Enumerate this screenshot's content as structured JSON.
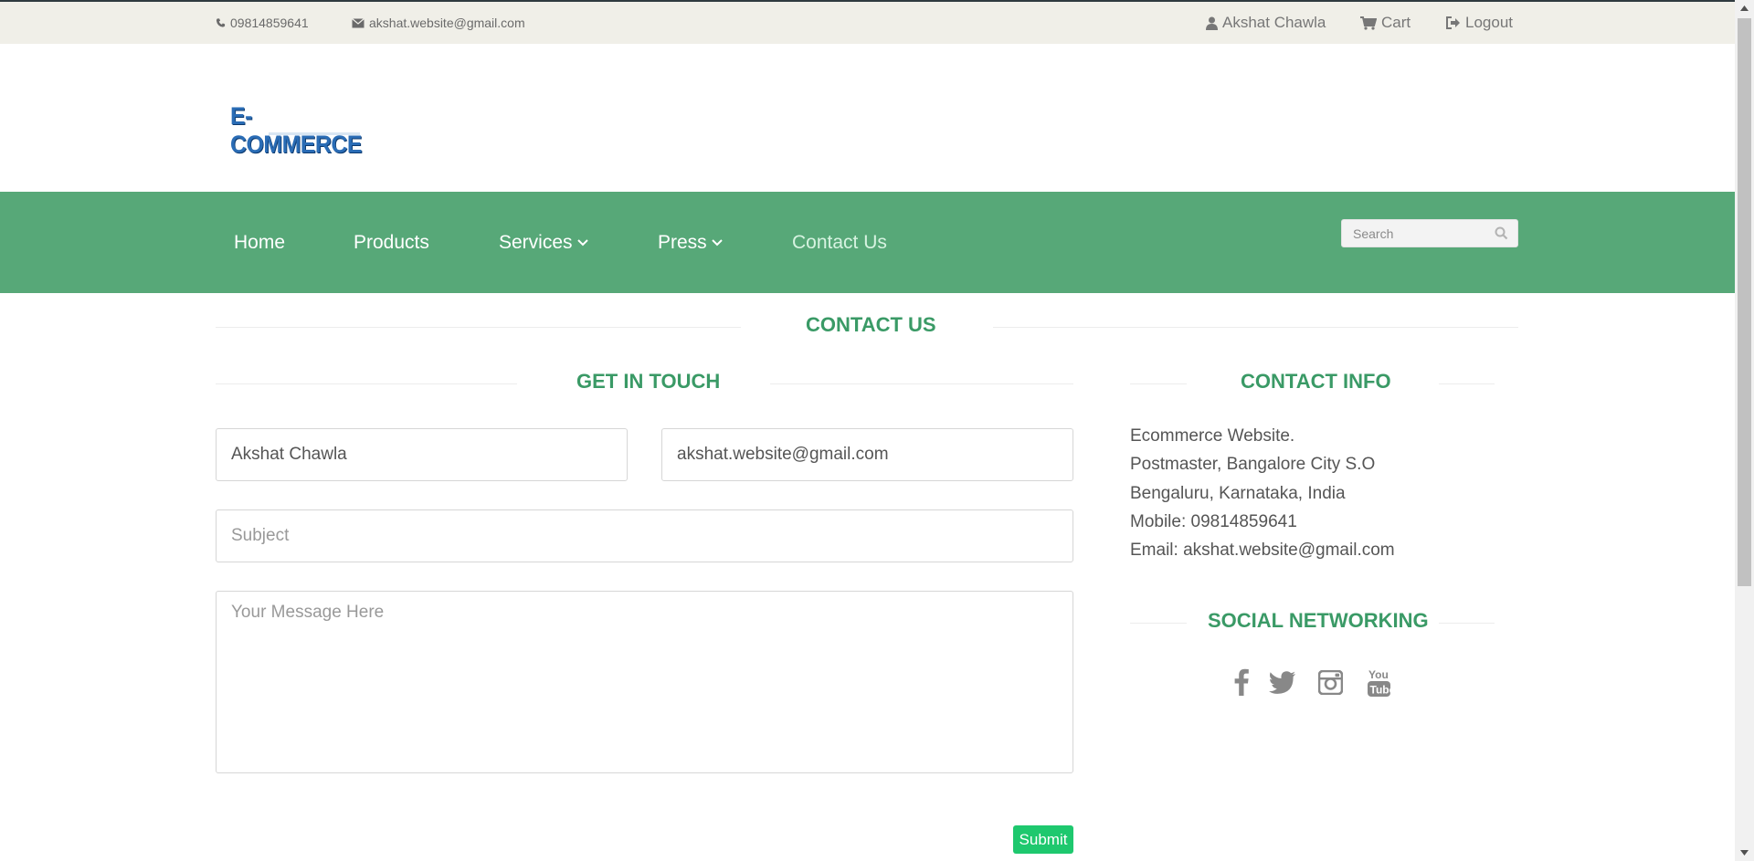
{
  "topbar": {
    "phone": "09814859641",
    "email": "akshat.website@gmail.com",
    "user_name": "Akshat Chawla",
    "cart_label": "Cart",
    "logout_label": "Logout"
  },
  "logo": {
    "text": "E-COMMERCE"
  },
  "nav": {
    "items": [
      {
        "label": "Home"
      },
      {
        "label": "Products"
      },
      {
        "label": "Services"
      },
      {
        "label": "Press"
      },
      {
        "label": "Contact Us"
      }
    ],
    "search_placeholder": "Search"
  },
  "page": {
    "title": "CONTACT US",
    "form_title": "GET IN TOUCH",
    "info_title": "CONTACT INFO",
    "social_title": "SOCIAL NETWORKING"
  },
  "form": {
    "name_value": "Akshat Chawla",
    "email_value": "akshat.website@gmail.com",
    "subject_placeholder": "Subject",
    "message_placeholder": "Your Message Here",
    "submit_label": "Submit"
  },
  "contact_info": {
    "lines": [
      "Ecommerce Website.",
      "Postmaster, Bangalore City S.O",
      "Bengaluru, Karnataka, India",
      "Mobile: 09814859641",
      "Email: akshat.website@gmail.com"
    ]
  },
  "social": {
    "icons": [
      "facebook-icon",
      "twitter-icon",
      "instagram-icon",
      "youtube-icon"
    ]
  },
  "colors": {
    "nav_green": "#57a878",
    "title_green": "#3a9a66",
    "submit_green": "#1ec86e",
    "topbar_bg": "#f0efe8"
  }
}
